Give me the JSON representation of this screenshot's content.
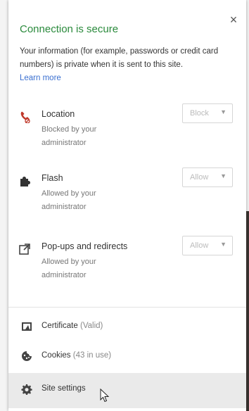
{
  "popup": {
    "title": "Connection is secure",
    "description": "Your information (for example, passwords or credit card numbers) is private when it is sent to this site.",
    "learn_more": "Learn more",
    "close_glyph": "×"
  },
  "permissions": [
    {
      "name": "Location",
      "status": "Blocked by your administrator",
      "value": "Block",
      "icon": "location-icon"
    },
    {
      "name": "Flash",
      "status": "Allowed by your administrator",
      "value": "Allow",
      "icon": "puzzle-icon"
    },
    {
      "name": "Pop-ups and redirects",
      "status": "Allowed by your administrator",
      "value": "Allow",
      "icon": "popup-icon"
    }
  ],
  "dropdown_arrow": "▼",
  "links": {
    "certificate_label": "Certificate",
    "certificate_status": "(Valid)",
    "cookies_label": "Cookies",
    "cookies_status": "(43 in use)",
    "site_settings_label": "Site settings"
  },
  "colors": {
    "secure_green": "#2a8a3c",
    "link_blue": "#3a6fd0",
    "location_red": "#c0392b"
  }
}
